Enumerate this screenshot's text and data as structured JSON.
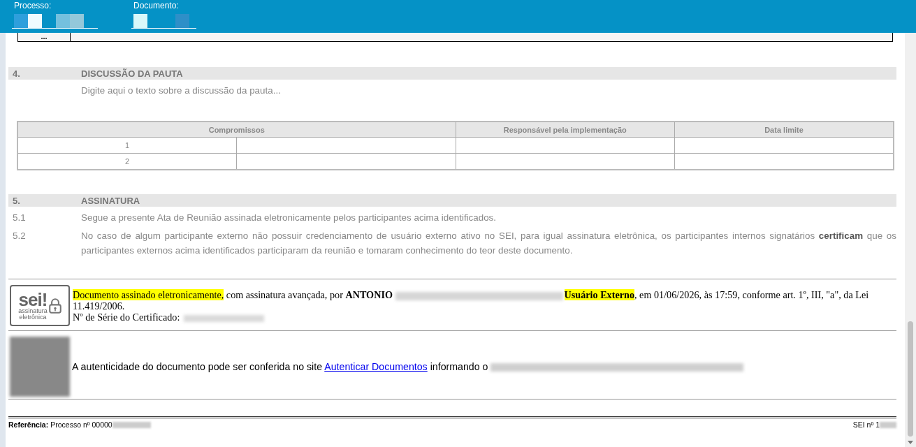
{
  "header": {
    "fields": [
      {
        "label": "Processo:"
      },
      {
        "label": "Documento:"
      }
    ]
  },
  "top_table": {
    "cell": "..."
  },
  "sections": [
    {
      "number": "4.",
      "title": "DISCUSSÃO DA PAUTA",
      "paragraphs": [
        {
          "text": "Digite aqui o texto sobre a discussão da pauta..."
        }
      ],
      "table": {
        "columns": [
          "Compromissos",
          "Responsável pela implementação",
          "Data limite"
        ],
        "rows": [
          {
            "number": "1"
          },
          {
            "number": "2"
          }
        ]
      }
    },
    {
      "number": "5.",
      "title": "ASSINATURA",
      "paragraphs": [
        {
          "number": "5.1",
          "text": "Segue a presente Ata de Reunião assinada eletronicamente pelos participantes acima identificados."
        },
        {
          "number": "5.2",
          "text": "No caso de algum participante externo não possuir credenciamento de usuário externo ativo no SEI, para igual assinatura eletrônica, os participantes internos signatários **certificam** que os participantes externos acima identificados participaram da reunião e tomaram conhecimento do teor deste documento."
        }
      ]
    }
  ],
  "signature": {
    "logo": {
      "mark": "sei!",
      "line1": "assinatura",
      "line2": "eletrônica"
    },
    "segments": [
      {
        "kind": "text",
        "text": "Documento assinado eletronicamente,",
        "highlight": true
      },
      {
        "kind": "text",
        "text": " com assinatura avançada, por **ANTONIO** ",
        "highlight": false
      },
      {
        "kind": "redacted"
      },
      {
        "kind": "text",
        "text": "**Usuário Externo**",
        "highlight": true
      },
      {
        "kind": "text",
        "text": ", em 01/06/2026, às 17:59, conforme art. 1º, III, \"a\", da Lei 11.419/2006.",
        "highlight": false
      }
    ],
    "serial_label": "Nº de Série do Certificado:"
  },
  "authenticity": {
    "before": "A autenticidade do documento pode ser conferida no site",
    "link": "Autenticar Documentos",
    "after": "informando o"
  },
  "footer": {
    "left": "**Referência:** Processo nº 00000",
    "right": "SEI nº 1"
  }
}
